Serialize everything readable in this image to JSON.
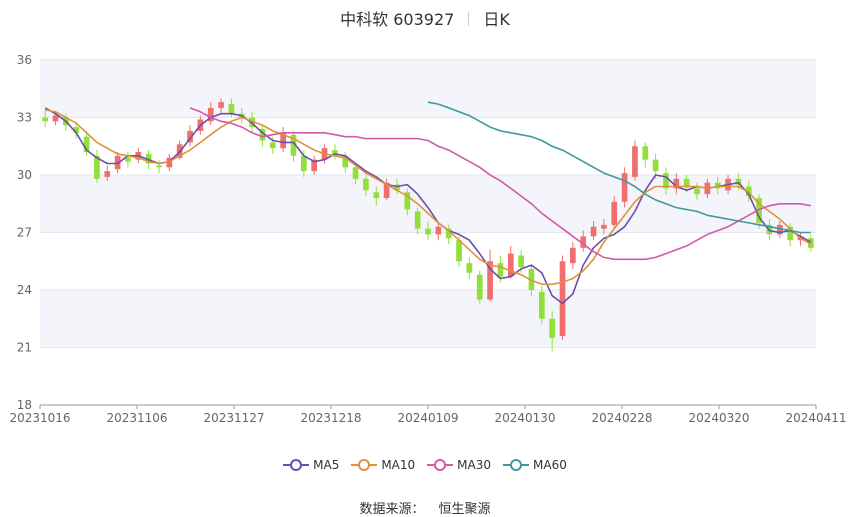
{
  "title": {
    "name": "中科软 603927",
    "period": "日K"
  },
  "source": {
    "label": "数据来源：",
    "value": "恒生聚源"
  },
  "colors": {
    "up": "#f06e6e",
    "down": "#8fe13a",
    "ma5": "#6b4fa8",
    "ma10": "#e0913a",
    "ma30": "#d25aa8",
    "ma60": "#3e9a9a",
    "bandA": "#f4f5fb",
    "bandB": "#ffffff"
  },
  "chart_data": {
    "type": "candlestick",
    "ylim": [
      18,
      36
    ],
    "yticks": [
      "18",
      "21",
      "24",
      "27",
      "30",
      "33",
      "36"
    ],
    "xticks": [
      "20231016",
      "20231106",
      "20231127",
      "20231218",
      "20240109",
      "20240130",
      "20240228",
      "20240320",
      "20240411"
    ],
    "series": [
      {
        "name": "MA5",
        "values": [
          33.5,
          33.2,
          32.8,
          32.2,
          31.3,
          30.9,
          30.6,
          30.6,
          31.0,
          31.0,
          30.8,
          30.6,
          30.7,
          31.2,
          31.9,
          32.6,
          33.0,
          33.2,
          33.2,
          33.1,
          32.7,
          32.2,
          31.8,
          31.7,
          31.7,
          31.0,
          30.7,
          30.8,
          31.1,
          31.0,
          30.6,
          30.2,
          29.9,
          29.5,
          29.4,
          29.5,
          29.0,
          28.3,
          27.5,
          27.1,
          26.9,
          26.6,
          25.9,
          25.1,
          24.6,
          24.7,
          25.1,
          25.3,
          24.9,
          23.7,
          23.3,
          23.8,
          25.3,
          26.2,
          26.7,
          26.9,
          27.3,
          28.1,
          29.2,
          30.0,
          29.9,
          29.4,
          29.2,
          29.4,
          29.3,
          29.4,
          29.5,
          29.6,
          29.0,
          27.8,
          27.1,
          27.0,
          27.1,
          26.8,
          26.5
        ]
      },
      {
        "name": "MA10",
        "values": [
          33.4,
          33.3,
          33.0,
          32.7,
          32.2,
          31.7,
          31.4,
          31.1,
          31.0,
          30.9,
          30.7,
          30.6,
          30.7,
          31.0,
          31.3,
          31.7,
          32.1,
          32.5,
          32.8,
          33.0,
          32.8,
          32.6,
          32.3,
          32.1,
          31.9,
          31.6,
          31.3,
          31.1,
          31.0,
          30.9,
          30.5,
          30.1,
          29.8,
          29.5,
          29.2,
          28.9,
          28.5,
          28.0,
          27.5,
          27.1,
          26.6,
          26.1,
          25.6,
          25.3,
          25.2,
          25.0,
          24.8,
          24.5,
          24.3,
          24.3,
          24.4,
          24.6,
          25.0,
          25.6,
          26.5,
          27.2,
          27.9,
          28.6,
          29.1,
          29.4,
          29.4,
          29.4,
          29.4,
          29.4,
          29.3,
          29.4,
          29.4,
          29.4,
          29.1,
          28.5,
          28.1,
          27.7,
          27.2,
          26.7,
          26.4
        ]
      },
      {
        "name": "MA30",
        "values": [
          33.5,
          33.3,
          33.0,
          32.8,
          32.7,
          32.5,
          32.2,
          32.0,
          32.1,
          32.2,
          32.2,
          32.2,
          32.2,
          32.2,
          32.1,
          32.0,
          32.0,
          31.9,
          31.9,
          31.9,
          31.9,
          31.9,
          31.9,
          31.8,
          31.5,
          31.3,
          31.0,
          30.7,
          30.4,
          30.0,
          29.7,
          29.3,
          28.9,
          28.5,
          28.0,
          27.6,
          27.2,
          26.8,
          26.4,
          26.0,
          25.7,
          25.6,
          25.6,
          25.6,
          25.6,
          25.7,
          25.9,
          26.1,
          26.3,
          26.6,
          26.9,
          27.1,
          27.3,
          27.6,
          27.9,
          28.2,
          28.4,
          28.5,
          28.5,
          28.5,
          28.4
        ]
      },
      {
        "name": "MA60",
        "values": [
          33.8,
          33.7,
          33.5,
          33.3,
          33.1,
          32.8,
          32.5,
          32.3,
          32.2,
          32.1,
          32.0,
          31.8,
          31.5,
          31.3,
          31.0,
          30.7,
          30.4,
          30.1,
          29.9,
          29.7,
          29.4,
          29.0,
          28.7,
          28.5,
          28.3,
          28.2,
          28.1,
          27.9,
          27.8,
          27.7,
          27.6,
          27.5,
          27.4,
          27.3,
          27.2,
          27.1,
          27.0,
          27.0
        ]
      }
    ],
    "candles": [
      [
        33.0,
        32.8,
        33.4,
        32.5
      ],
      [
        32.8,
        33.1,
        33.3,
        32.6
      ],
      [
        33.0,
        32.6,
        33.2,
        32.3
      ],
      [
        32.5,
        32.2,
        32.8,
        31.9
      ],
      [
        32.0,
        31.2,
        32.3,
        31.0
      ],
      [
        31.0,
        29.8,
        31.3,
        29.6
      ],
      [
        29.9,
        30.2,
        30.5,
        29.7
      ],
      [
        30.3,
        31.0,
        31.2,
        30.1
      ],
      [
        30.9,
        30.7,
        31.2,
        30.4
      ],
      [
        30.8,
        31.2,
        31.4,
        30.6
      ],
      [
        31.1,
        30.6,
        31.3,
        30.3
      ],
      [
        30.5,
        30.4,
        30.8,
        30.1
      ],
      [
        30.4,
        30.9,
        31.1,
        30.2
      ],
      [
        30.9,
        31.6,
        31.8,
        30.8
      ],
      [
        31.7,
        32.3,
        32.6,
        31.5
      ],
      [
        32.3,
        32.9,
        33.1,
        32.1
      ],
      [
        32.8,
        33.5,
        33.8,
        32.6
      ],
      [
        33.5,
        33.8,
        34.0,
        33.2
      ],
      [
        33.7,
        33.2,
        34.0,
        33.0
      ],
      [
        33.2,
        33.0,
        33.5,
        32.7
      ],
      [
        33.0,
        32.5,
        33.3,
        32.2
      ],
      [
        32.4,
        31.8,
        32.6,
        31.5
      ],
      [
        31.7,
        31.4,
        32.0,
        31.1
      ],
      [
        31.4,
        32.2,
        32.5,
        31.2
      ],
      [
        32.1,
        31.0,
        32.3,
        30.7
      ],
      [
        31.0,
        30.2,
        31.3,
        29.9
      ],
      [
        30.2,
        30.8,
        31.0,
        30.0
      ],
      [
        30.8,
        31.4,
        31.6,
        30.6
      ],
      [
        31.3,
        31.0,
        31.6,
        30.8
      ],
      [
        31.0,
        30.4,
        31.2,
        30.1
      ],
      [
        30.4,
        29.8,
        30.6,
        29.5
      ],
      [
        29.8,
        29.2,
        30.0,
        28.9
      ],
      [
        29.1,
        28.8,
        29.4,
        28.4
      ],
      [
        28.8,
        29.6,
        29.8,
        28.7
      ],
      [
        29.5,
        29.2,
        29.8,
        29.0
      ],
      [
        29.1,
        28.2,
        29.3,
        27.9
      ],
      [
        28.1,
        27.2,
        28.3,
        26.9
      ],
      [
        27.2,
        26.9,
        27.6,
        26.6
      ],
      [
        26.9,
        27.3,
        27.5,
        26.6
      ],
      [
        27.2,
        26.7,
        27.4,
        26.4
      ],
      [
        26.6,
        25.5,
        26.8,
        25.2
      ],
      [
        25.4,
        24.9,
        25.7,
        24.6
      ],
      [
        24.8,
        23.5,
        25.0,
        23.3
      ],
      [
        23.5,
        25.5,
        26.1,
        23.4
      ],
      [
        25.4,
        24.7,
        25.8,
        24.4
      ],
      [
        24.7,
        25.9,
        26.3,
        24.6
      ],
      [
        25.8,
        25.2,
        26.1,
        24.9
      ],
      [
        25.1,
        24.0,
        25.3,
        23.7
      ],
      [
        23.9,
        22.5,
        24.2,
        22.2
      ],
      [
        22.5,
        21.5,
        22.9,
        20.8
      ],
      [
        21.6,
        25.5,
        25.8,
        21.4
      ],
      [
        25.4,
        26.2,
        26.5,
        25.1
      ],
      [
        26.2,
        26.8,
        27.1,
        26.0
      ],
      [
        26.8,
        27.3,
        27.6,
        26.6
      ],
      [
        27.2,
        27.4,
        27.7,
        26.9
      ],
      [
        27.4,
        28.6,
        28.9,
        27.2
      ],
      [
        28.6,
        30.1,
        30.4,
        28.3
      ],
      [
        29.9,
        31.5,
        31.8,
        29.7
      ],
      [
        31.5,
        30.8,
        31.7,
        30.4
      ],
      [
        30.8,
        30.2,
        31.1,
        29.8
      ],
      [
        30.1,
        29.3,
        30.4,
        29.0
      ],
      [
        29.3,
        29.8,
        30.1,
        29.0
      ],
      [
        29.8,
        29.4,
        30.0,
        29.1
      ],
      [
        29.3,
        29.0,
        29.6,
        28.7
      ],
      [
        29.0,
        29.6,
        29.8,
        28.8
      ],
      [
        29.6,
        29.3,
        29.9,
        29.0
      ],
      [
        29.2,
        29.8,
        30.0,
        29.0
      ],
      [
        29.8,
        29.5,
        30.1,
        29.2
      ],
      [
        29.4,
        28.9,
        29.7,
        28.6
      ],
      [
        28.8,
        27.5,
        29.0,
        27.2
      ],
      [
        27.4,
        26.9,
        27.7,
        26.6
      ],
      [
        26.9,
        27.4,
        27.6,
        26.7
      ],
      [
        27.3,
        26.6,
        27.5,
        26.3
      ],
      [
        26.6,
        26.8,
        27.0,
        26.3
      ],
      [
        26.7,
        26.2,
        26.9,
        26.0
      ]
    ]
  }
}
